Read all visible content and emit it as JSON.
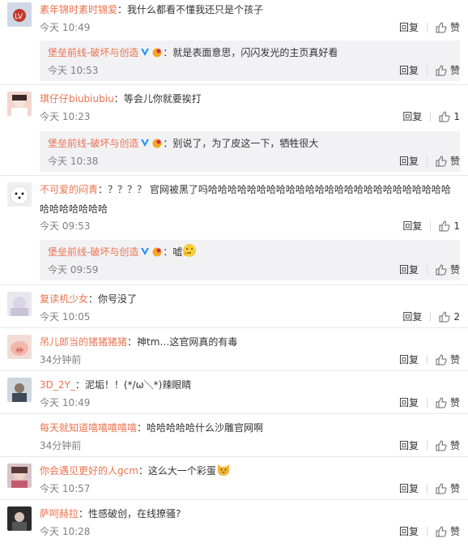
{
  "ui": {
    "reply_label": "回复",
    "like_label": "赞"
  },
  "brand_reply_user": "堡垒前线-破坏与创造",
  "colors": {
    "username": "#eb7350",
    "meta": "#808080",
    "reply_bg": "#f2f2f5"
  },
  "comments": [
    {
      "user": "素年锦时素时锦爱",
      "text": "我什么都看不懂我还只是个孩子",
      "time": "今天 10:49",
      "likes": "赞",
      "reply": {
        "text": "就是表面意思，闪闪发光的主页真好看",
        "time": "今天 10:53",
        "likes": "赞"
      }
    },
    {
      "user": "琪仔仔biubiubiu",
      "text": "等会儿你就要挨打",
      "time": "今天 10:23",
      "likes": "1",
      "reply": {
        "text": "别说了，为了皮这一下，牺牲很大",
        "time": "今天 10:38",
        "likes": "赞"
      }
    },
    {
      "user": "不可爱的闷青",
      "text": "？？？？ 官网被黑了吗哈哈哈哈哈哈哈哈哈哈哈哈哈哈哈哈哈哈哈哈哈哈哈哈哈哈哈哈哈哈哈哈",
      "time": "今天 09:53",
      "likes": "1",
      "reply": {
        "text": "嘘",
        "time": "今天 09:59",
        "likes": "赞"
      }
    },
    {
      "user": "复读机少女",
      "text": "你号没了",
      "time": "今天 10:05",
      "likes": "2"
    },
    {
      "user": "吊儿郎当的猪猪猪猪",
      "text": "神tm…这官网真的有毒",
      "time": "34分钟前",
      "likes": "赞"
    },
    {
      "user": "3D_2Y_",
      "text": "泥垢！！(*/ω＼*)辣眼睛",
      "time": "今天 10:49",
      "likes": "赞"
    },
    {
      "user": "每天就知道嘻嘻嘻嘻嘻",
      "text": "哈哈哈哈哈什么沙雕官网啊",
      "time": "34分钟前",
      "likes": "赞"
    },
    {
      "user": "你会遇见更好的人gcm",
      "text": "这么大一个彩蛋",
      "time": "今天 10:57",
      "likes": "赞"
    },
    {
      "user": "萨呵赫拉",
      "text": "性感破创，在线撩骚?",
      "time": "今天 10:28",
      "likes": "赞"
    }
  ]
}
